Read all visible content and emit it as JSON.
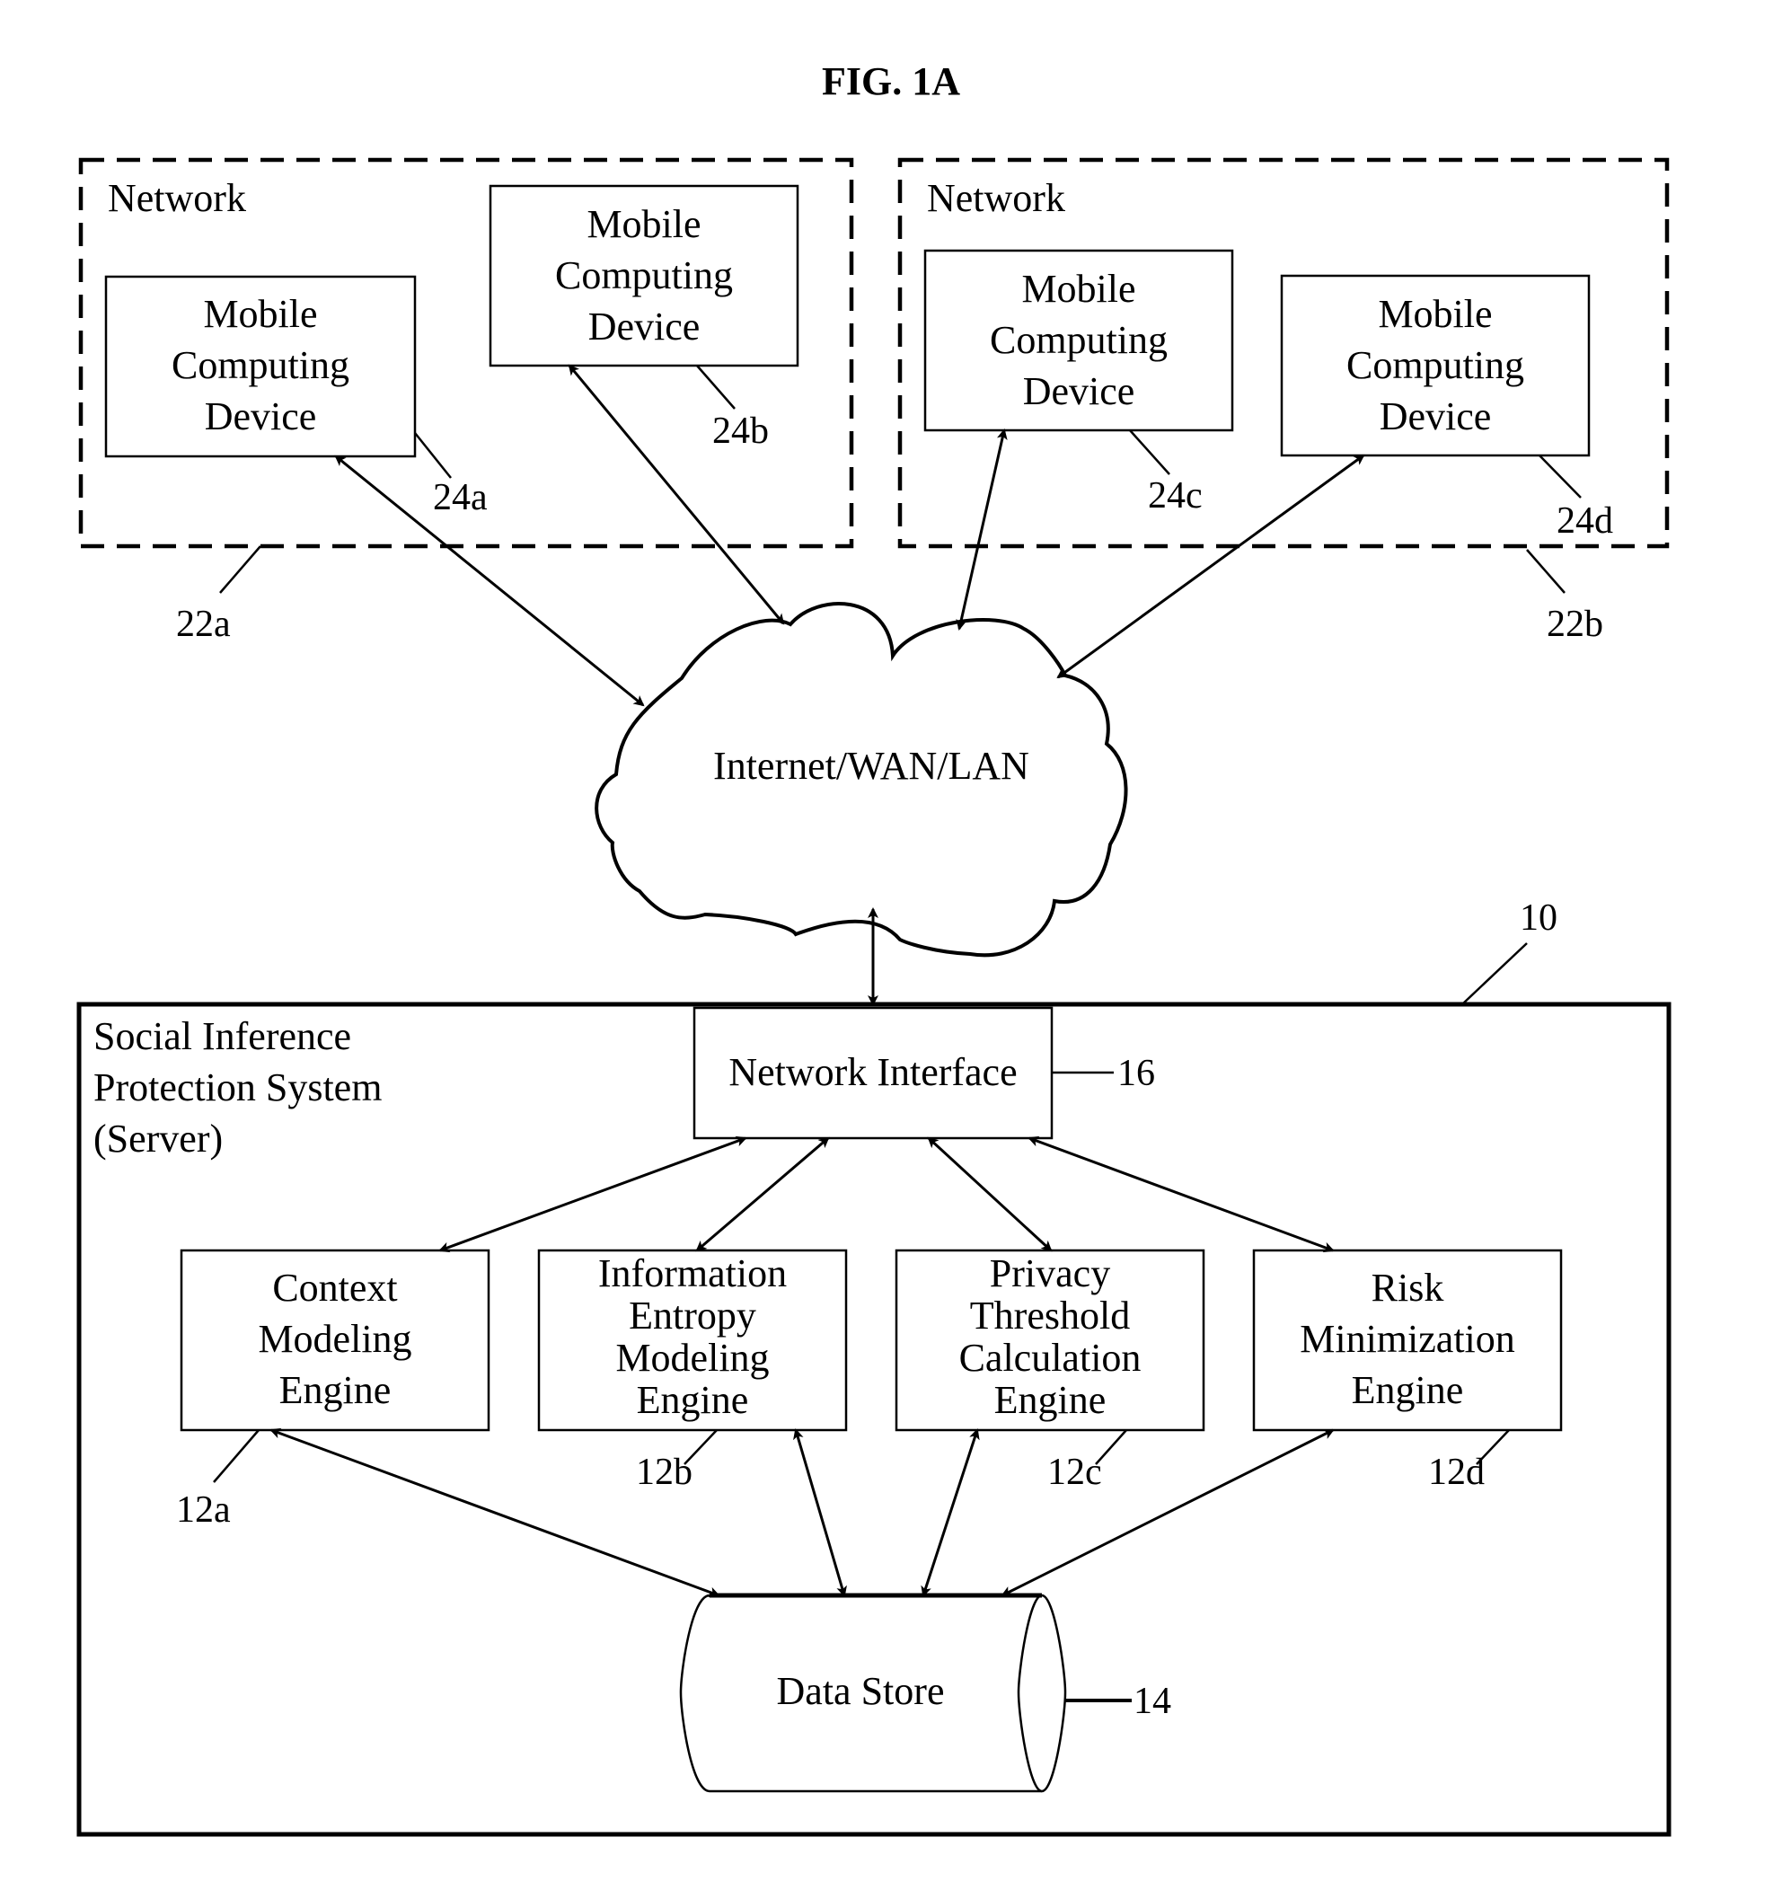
{
  "figure": {
    "title": "FIG. 1A",
    "networks": [
      {
        "label": "Network",
        "ref": "22a",
        "devices": [
          {
            "lines": [
              "Mobile",
              "Computing",
              "Device"
            ],
            "ref": "24a"
          },
          {
            "lines": [
              "Mobile",
              "Computing",
              "Device"
            ],
            "ref": "24b"
          }
        ]
      },
      {
        "label": "Network",
        "ref": "22b",
        "devices": [
          {
            "lines": [
              "Mobile",
              "Computing",
              "Device"
            ],
            "ref": "24c"
          },
          {
            "lines": [
              "Mobile",
              "Computing",
              "Device"
            ],
            "ref": "24d"
          }
        ]
      }
    ],
    "cloud": {
      "label": "Internet/WAN/LAN"
    },
    "server": {
      "title_lines": [
        "Social Inference",
        "Protection System",
        "(Server)"
      ],
      "ref": "10",
      "network_interface": {
        "label": "Network Interface",
        "ref": "16"
      },
      "engines": [
        {
          "lines": [
            "Context",
            "Modeling",
            "Engine"
          ],
          "ref": "12a"
        },
        {
          "lines": [
            "Information",
            "Entropy",
            "Modeling",
            "Engine"
          ],
          "ref": "12b"
        },
        {
          "lines": [
            "Privacy",
            "Threshold",
            "Calculation",
            "Engine"
          ],
          "ref": "12c"
        },
        {
          "lines": [
            "Risk",
            "Minimization",
            "Engine"
          ],
          "ref": "12d"
        }
      ],
      "data_store": {
        "label": "Data Store",
        "ref": "14"
      }
    }
  }
}
